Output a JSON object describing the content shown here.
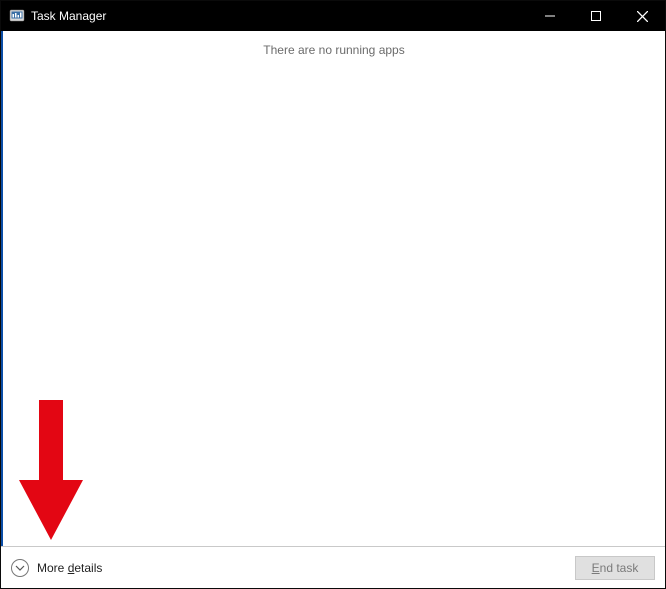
{
  "titlebar": {
    "title": "Task Manager"
  },
  "content": {
    "empty_message": "There are no running apps"
  },
  "footer": {
    "more_details_label": "More details",
    "end_task_prefix": "E",
    "end_task_rest": "nd task"
  }
}
